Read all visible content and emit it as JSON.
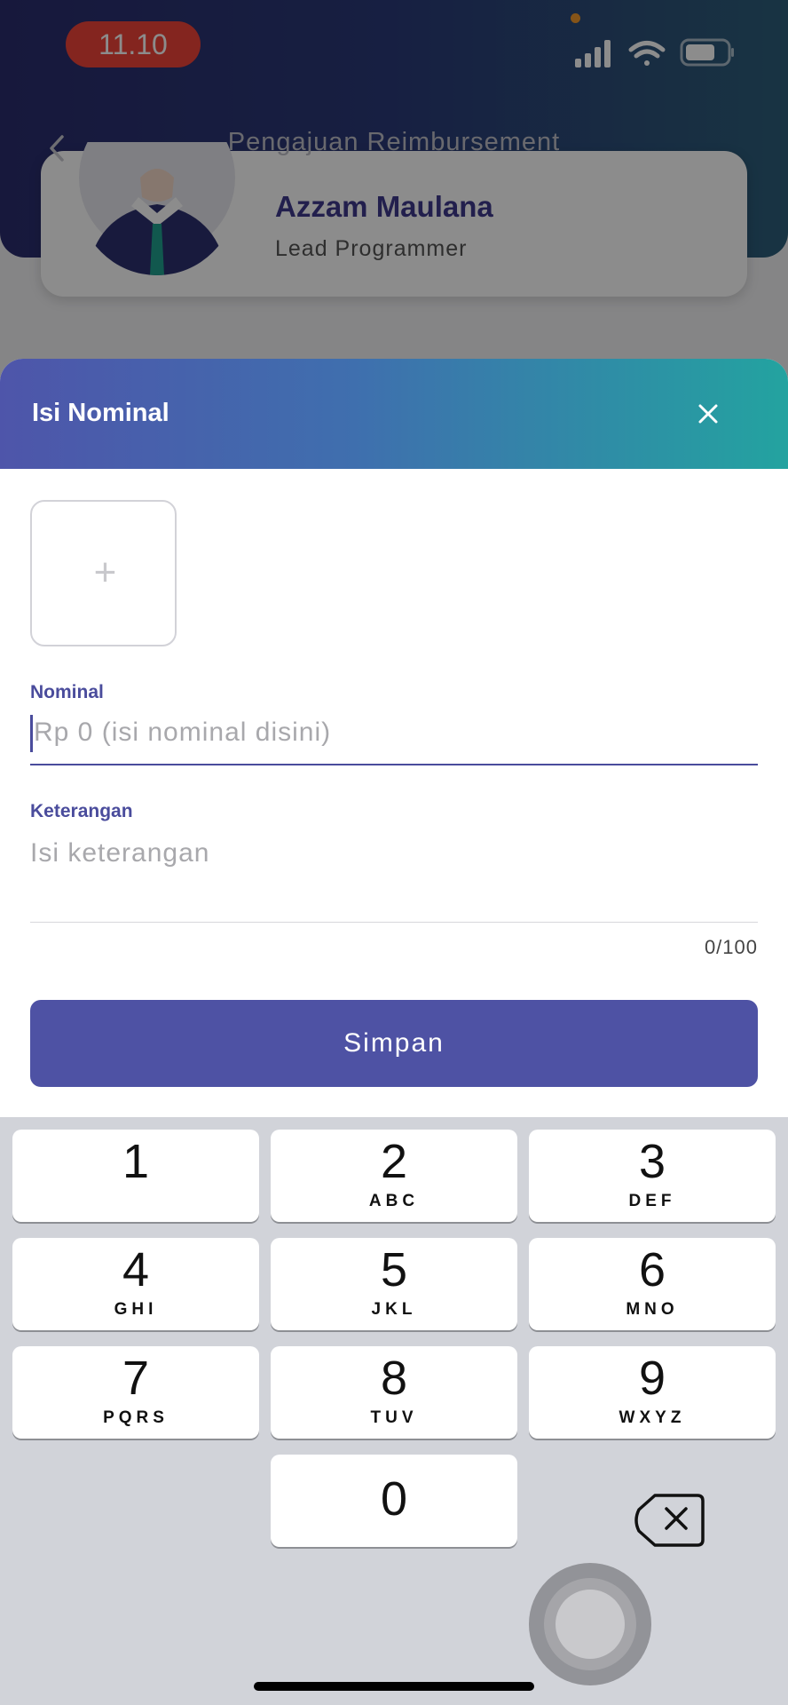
{
  "status_bar": {
    "time": "11.10",
    "colors": {
      "time_pill": "#f0443a",
      "mic_dot": "#f39a2c"
    }
  },
  "nav": {
    "title": "Pengajuan Reimbursement"
  },
  "profile": {
    "name": "Azzam Maulana",
    "role": "Lead Programmer"
  },
  "sheet": {
    "title": "Isi Nominal",
    "upload_plus": "+",
    "nominal": {
      "label": "Nominal",
      "placeholder": "Rp 0 (isi nominal disini)",
      "value": ""
    },
    "keterangan": {
      "label": "Keterangan",
      "placeholder": "Isi keterangan",
      "value": "",
      "counter": "0/100"
    },
    "save_label": "Simpan",
    "colors": {
      "primary": "#4e52a4",
      "header_start": "#4e55aa",
      "header_end": "#23a3a0"
    }
  },
  "keyboard": {
    "keys": [
      {
        "num": "1",
        "letters": ""
      },
      {
        "num": "2",
        "letters": "ABC"
      },
      {
        "num": "3",
        "letters": "DEF"
      },
      {
        "num": "4",
        "letters": "GHI"
      },
      {
        "num": "5",
        "letters": "JKL"
      },
      {
        "num": "6",
        "letters": "MNO"
      },
      {
        "num": "7",
        "letters": "PQRS"
      },
      {
        "num": "8",
        "letters": "TUV"
      },
      {
        "num": "9",
        "letters": "WXYZ"
      },
      {
        "num": "0",
        "letters": ""
      }
    ],
    "backspace_icon": "delete-left-icon"
  }
}
